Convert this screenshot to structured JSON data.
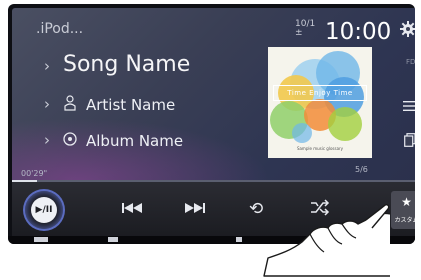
{
  "header": {
    "source": ".iPod...",
    "date_top": "10/",
    "date_num": "1",
    "date_bottom": "±",
    "time": "10:00"
  },
  "track": {
    "song": "Song Name",
    "artist": "Artist Name",
    "album": "Album Name",
    "elapsed": "00'29\"",
    "track_number": "5/6",
    "progress": 0.06
  },
  "cover": {
    "title": "Time Enjoy Time",
    "subtitle": "Sample music glossary",
    "bubble_colors": [
      "#6fb6e8",
      "#9fd0f0",
      "#f2c94c",
      "#8fcf6a",
      "#f28c38",
      "#a2cf3e"
    ]
  },
  "side": {
    "icon_a": "FD"
  },
  "controls": {
    "play_pause": "▶/II",
    "prev": "⏮",
    "next": "⏭",
    "repeat": "⟲",
    "custom_label": "カスタム"
  },
  "colors": {
    "accent": "#5b6cc0",
    "background": "#2e3552"
  }
}
